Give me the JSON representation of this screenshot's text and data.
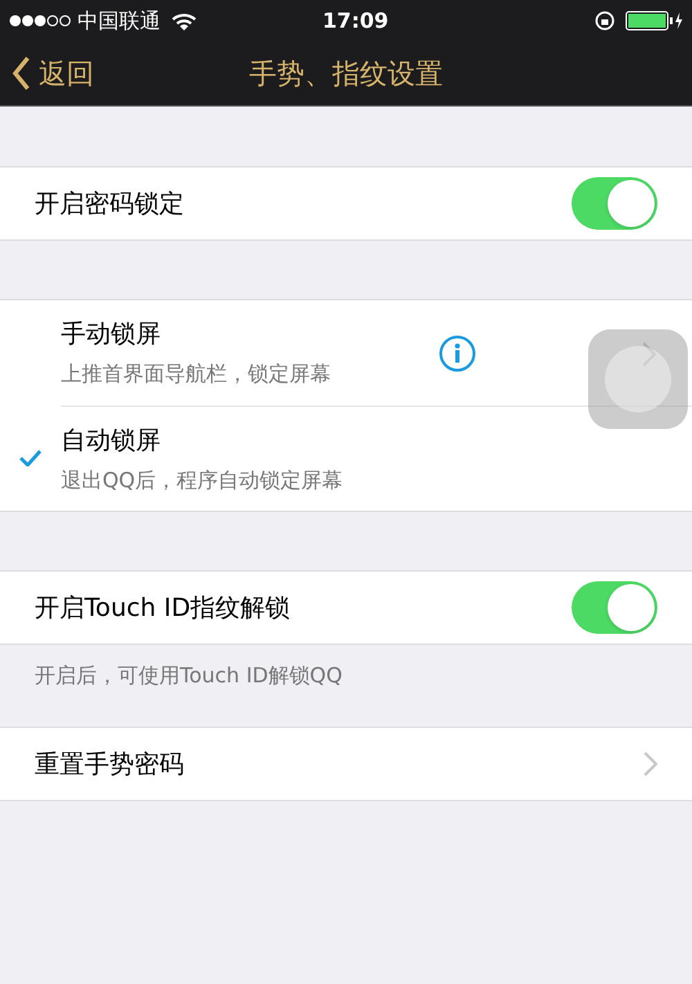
{
  "status_bar": {
    "carrier": "中国联通",
    "time": "17:09"
  },
  "nav_bar": {
    "back": "返回",
    "title": "手势、指纹设置"
  },
  "passcode_lock": {
    "label": "开启密码锁定",
    "on": true
  },
  "lock_options": [
    {
      "title": "手动锁屏",
      "subtitle": "上推首界面导航栏，锁定屏幕",
      "selected": false
    },
    {
      "title": "自动锁屏",
      "subtitle": "退出QQ后，程序自动锁定屏幕",
      "selected": true
    }
  ],
  "touch_id": {
    "label": "开启Touch ID指纹解锁",
    "on": true,
    "footer": "开启后，可使用Touch ID解锁QQ"
  },
  "reset_gesture": {
    "label": "重置手势密码"
  }
}
